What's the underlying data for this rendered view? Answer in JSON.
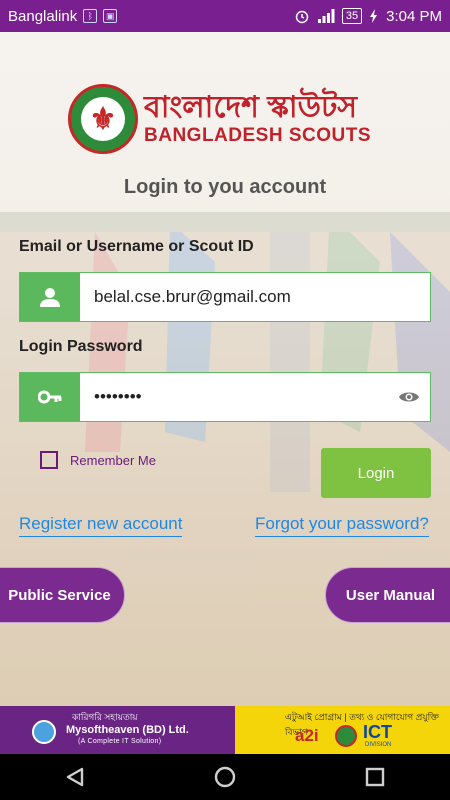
{
  "status_bar": {
    "carrier": "Banglalink",
    "battery": "35",
    "time": "3:04 PM"
  },
  "brand": {
    "name_bn": "বাংলাদেশ স্কাউটস",
    "name_en": "BANGLADESH SCOUTS"
  },
  "heading": "Login to you account",
  "form": {
    "username_label": "Email or Username or Scout ID",
    "username_value": "belal.cse.brur@gmail.com",
    "password_label": "Login Password",
    "password_value": "••••••••",
    "remember_label": "Remember Me",
    "login_button": "Login"
  },
  "links": {
    "register": "Register new account",
    "forgot": "Forgot your password?"
  },
  "buttons": {
    "public_service": "Public Service",
    "user_manual": "User Manual"
  },
  "footer": {
    "sponsor_bn": "কারিগরি সহায়তায়",
    "sponsor_name": "Mysoftheaven (BD) Ltd.",
    "sponsor_tagline": "(A Complete IT Solution)",
    "gov_bn": "এটুআই প্রোগ্রাম | তথ্য ও যোগাযোগ প্রযুক্তি বিভাগ",
    "a2i": "a2i",
    "ict": "ICT",
    "ict_sub": "DIVISION"
  },
  "colors": {
    "status_bar": "#7a1f8f",
    "accent_green": "#5cb85c",
    "login_green": "#7fc241",
    "purple": "#7b2a8f",
    "link_blue": "#1e88e5",
    "brand_red": "#c0222b"
  },
  "icons": [
    "user-icon",
    "key-icon",
    "eye-icon",
    "back-icon",
    "home-icon",
    "recents-icon"
  ]
}
